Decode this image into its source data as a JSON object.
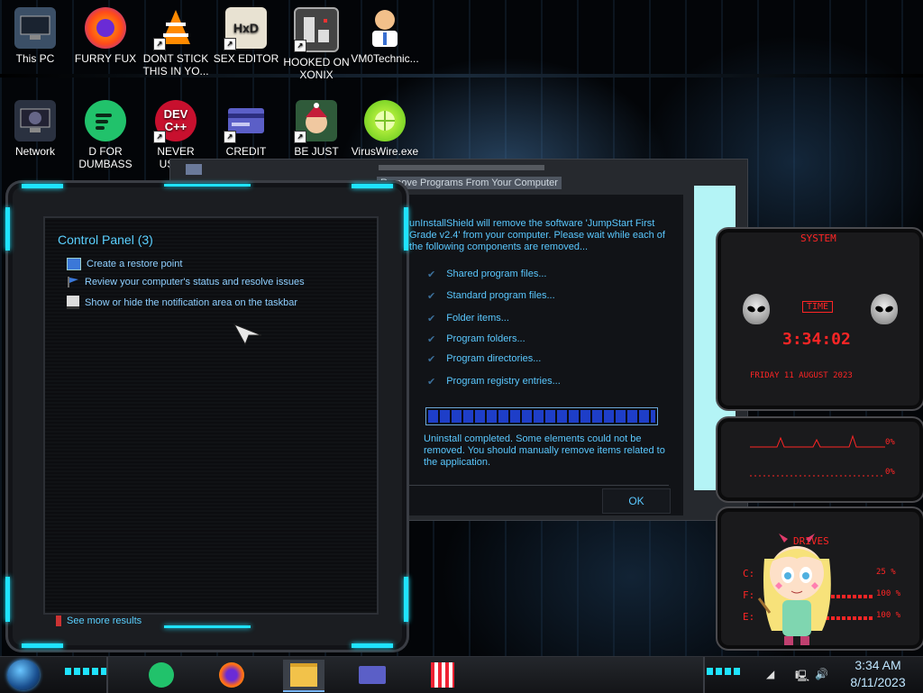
{
  "desktop_icons": [
    {
      "label": "This PC",
      "icon": "computer-icon"
    },
    {
      "label": "FURRY FUX",
      "icon": "firefox-icon"
    },
    {
      "label": "DONT STICK THIS IN YO...",
      "icon": "vlc-icon"
    },
    {
      "label": "SEX EDITOR",
      "icon": "hxd-icon"
    },
    {
      "label": "HOOKED ON XONIX",
      "icon": "xonix-icon"
    },
    {
      "label": "VM0Technic...",
      "icon": "doctor-icon"
    },
    {
      "label": "Network",
      "icon": "network-icon"
    },
    {
      "label": "D FOR DUMBASS",
      "icon": "d-app-icon"
    },
    {
      "label": "NEVER USED!",
      "icon": "devcpp-icon"
    },
    {
      "label": "CREDIT CARD",
      "icon": "credit-card-icon"
    },
    {
      "label": "BE JUST LIKE",
      "icon": "elf-icon"
    },
    {
      "label": "VirusWire.exe",
      "icon": "lime-icon"
    }
  ],
  "control_panel": {
    "title": "Control Panel (3)",
    "items": [
      {
        "label": "Create a restore point",
        "icon": "restore-icon"
      },
      {
        "label": "Review your computer's status and resolve issues",
        "icon": "flag-icon"
      },
      {
        "label": "Show or hide the notification area on the taskbar",
        "icon": "taskbar-icon"
      }
    ],
    "see_more": "See more results"
  },
  "uninstall_dialog": {
    "title": "Remove Programs From Your Computer",
    "message": "unInstallShield will remove the software 'JumpStart First Grade v2.4' from your computer.  Please wait while each of the following components are removed...",
    "components": [
      "Shared program files...",
      "Standard program files...",
      "Folder items...",
      "Program folders...",
      "Program directories...",
      "Program registry entries..."
    ],
    "progress": 1.0,
    "complete_message": "Uninstall completed.  Some elements could not be removed.  You should manually remove items related to the application.",
    "ok_label": "OK"
  },
  "gadget": {
    "system_label": "SYSTEM",
    "time_label": "TIME",
    "time": "3:34:02",
    "date": "FRIDAY 11 AUGUST 2023",
    "cpu_percent": "0%",
    "out_percent": "0%",
    "drives_label": "DRIVES",
    "drives": [
      {
        "letter": "C:",
        "percent": "25 %"
      },
      {
        "letter": "F:",
        "percent": "100 %"
      },
      {
        "letter": "E:",
        "percent": "100 %"
      }
    ]
  },
  "taskbar": {
    "apps": [
      "d-app-icon",
      "firefox-icon",
      "file-explorer-icon",
      "credit-card-icon",
      "popcorn-icon"
    ],
    "time": "3:34 AM",
    "date": "8/11/2023"
  },
  "colors": {
    "accent_cyan": "#1fe3ff",
    "text_blue": "#5ac8ff",
    "gadget_red": "#ff2525"
  }
}
